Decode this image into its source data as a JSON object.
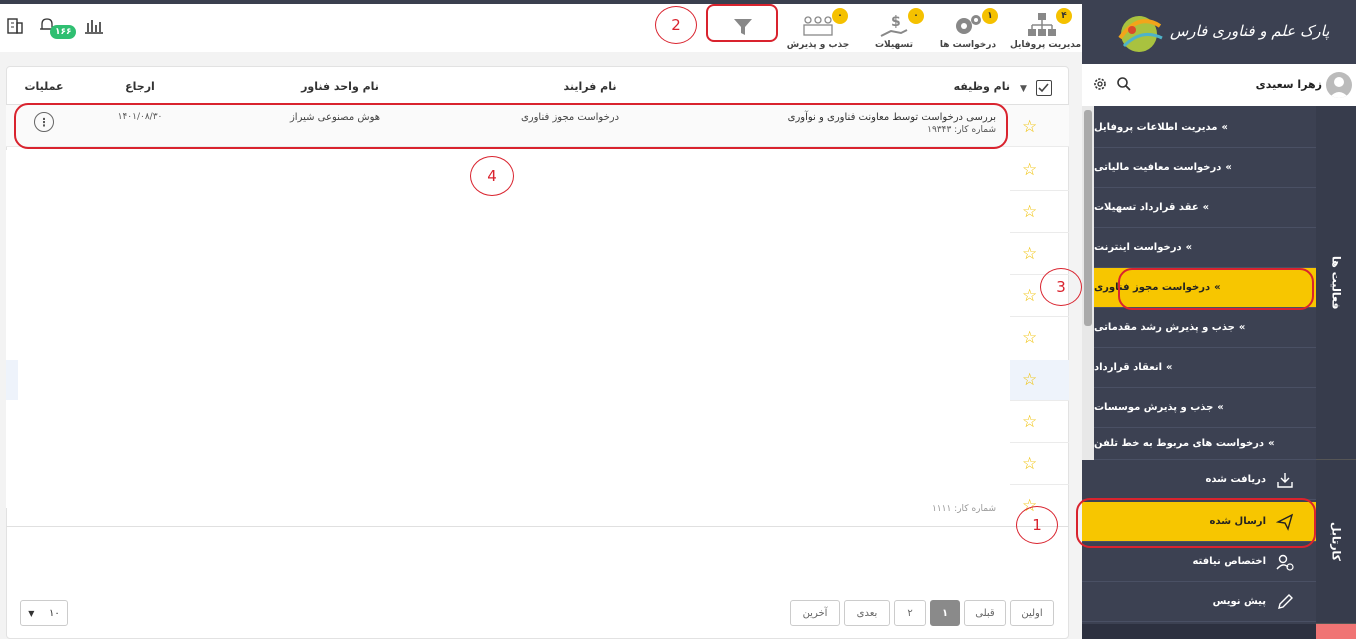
{
  "topbar": {
    "items": [
      {
        "label": "مدیریت پروفایل",
        "badge": "۴",
        "icon": "org-chart-icon"
      },
      {
        "label": "درخواست ها",
        "badge": "۱",
        "icon": "gears-icon"
      },
      {
        "label": "تسهیلات",
        "badge": "۰",
        "icon": "money-hand-icon"
      },
      {
        "label": "جذب و پذیرش",
        "badge": "۰",
        "icon": "group-icon"
      }
    ],
    "notification_count": "۱۶۶"
  },
  "brand": {
    "logo_text": "پارک علم و فناوری فارس"
  },
  "user": {
    "name": "زهرا سعیدی"
  },
  "sidebar": {
    "activities_tab": "فعالیت ها",
    "cartable_tab": "کارتابل",
    "activity_items": [
      "مدیریت اطلاعات پروفایل",
      "درخواست معافیت مالیاتی",
      "عقد قرارداد تسهیلات",
      "درخواست اینترنت",
      "درخواست مجوز فناوری",
      "جذب و پذیرش رشد مقدماتی",
      "انعقاد قرارداد",
      "جذب و پذیرش موسسات",
      "درخواست های مربوط به خط تلفن"
    ],
    "cartable_items": [
      "دریافت شده",
      "ارسال شده",
      "اختصاص نیافته",
      "پیش نویس"
    ]
  },
  "table": {
    "headers": {
      "task": "نام وظیفه",
      "process": "نام فرایند",
      "unit": "نام واحد فناور",
      "referral": "ارجاع",
      "actions": "عملیات"
    },
    "rows": [
      {
        "task": "بررسی درخواست توسط معاونت فناوری و نوآوری",
        "job_number": "شماره کار: ۱۹۳۴۳",
        "process": "درخواست مجوز فناوری",
        "unit": "هوش مصنوعی شیراز",
        "referral": "۱۴۰۱/۰۸/۳۰"
      }
    ],
    "faded_row_text": "شماره کار: ۱۱۱۱"
  },
  "pagination": {
    "first": "اولین",
    "prev": "قبلی",
    "pages": [
      "۱",
      "۲"
    ],
    "next": "بعدی",
    "last": "آخرین",
    "page_size": "۱۰"
  },
  "annotations": [
    "1",
    "2",
    "3",
    "4"
  ],
  "colors": {
    "accent": "#f7c600",
    "sidebar": "#3c4152",
    "annotation": "#d9232e"
  }
}
